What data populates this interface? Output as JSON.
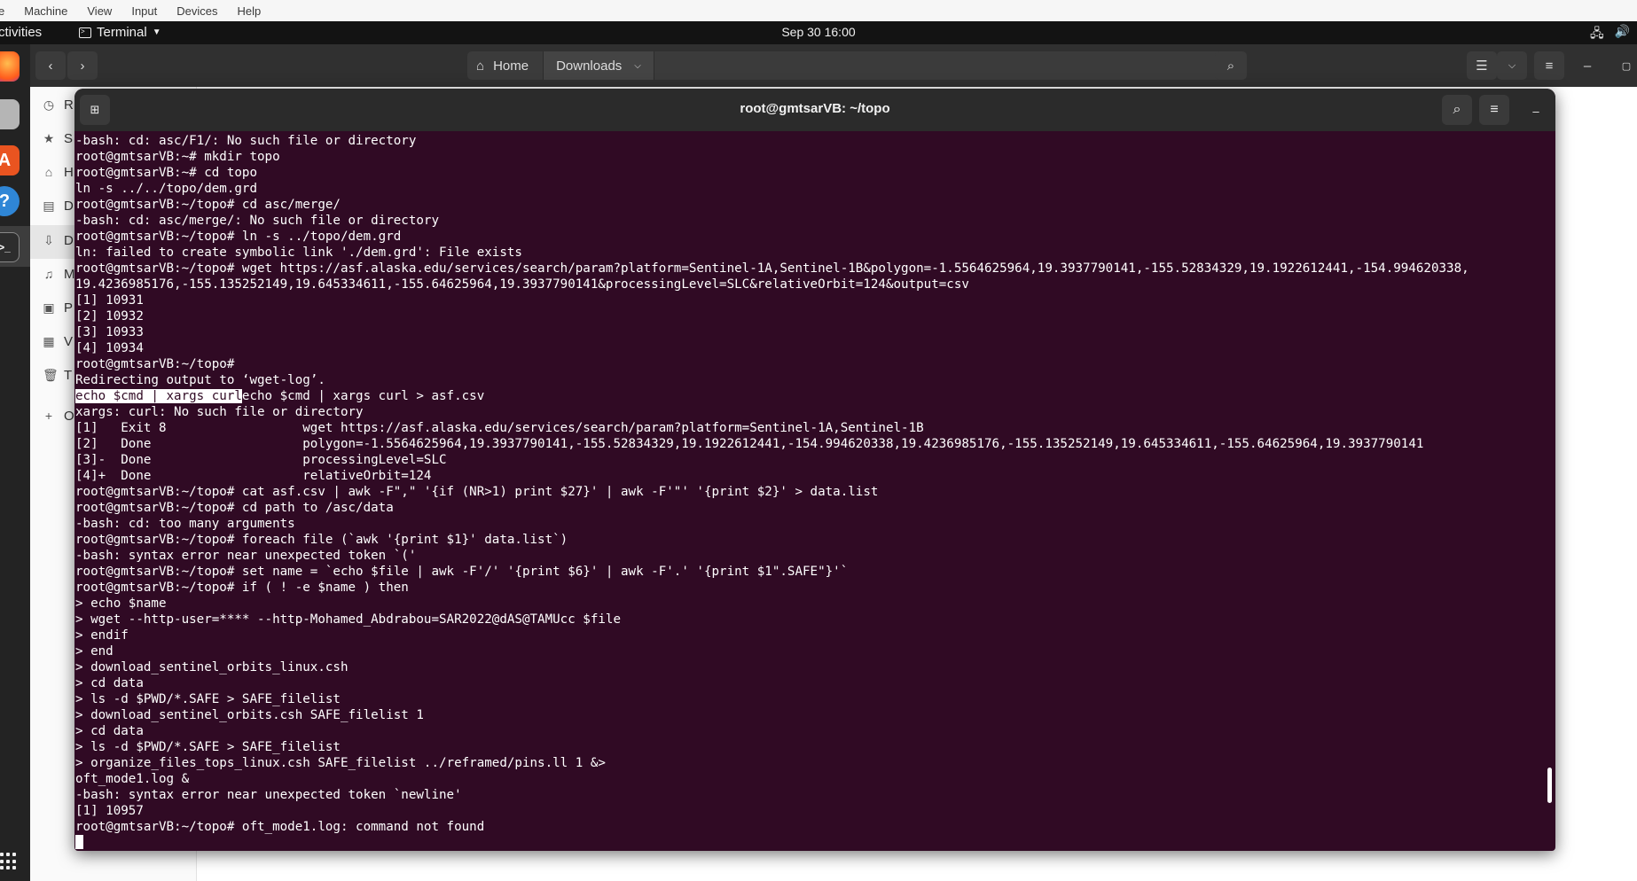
{
  "vbox_menu": {
    "items": [
      "e",
      "Machine",
      "View",
      "Input",
      "Devices",
      "Help"
    ]
  },
  "topbar": {
    "activities": "ctivities",
    "app_name": "Terminal",
    "clock": "Sep 30  16:00"
  },
  "files": {
    "path": {
      "home": "Home",
      "downloads": "Downloads"
    },
    "sidebar": [
      {
        "label": "R",
        "icon": "recent-icon"
      },
      {
        "label": "S",
        "icon": "star-icon"
      },
      {
        "label": "H",
        "icon": "home-icon"
      },
      {
        "label": "D",
        "icon": "documents-icon"
      },
      {
        "label": "D",
        "icon": "downloads-icon"
      },
      {
        "label": "M",
        "icon": "music-icon"
      },
      {
        "label": "P",
        "icon": "pictures-icon"
      },
      {
        "label": "V",
        "icon": "videos-icon"
      },
      {
        "label": "T",
        "icon": "trash-icon"
      },
      {
        "label": "O",
        "icon": "plus-icon"
      }
    ]
  },
  "terminal": {
    "title": "root@gmtsarVB: ~/topo",
    "lines": [
      "-bash: cd: asc/F1/: No such file or directory",
      "root@gmtsarVB:~# mkdir topo",
      "root@gmtsarVB:~# cd topo",
      "ln -s ../../topo/dem.grd",
      "root@gmtsarVB:~/topo# cd asc/merge/",
      "-bash: cd: asc/merge/: No such file or directory",
      "root@gmtsarVB:~/topo# ln -s ../topo/dem.grd",
      "ln: failed to create symbolic link './dem.grd': File exists",
      "root@gmtsarVB:~/topo# wget https://asf.alaska.edu/services/search/param?platform=Sentinel-1A,Sentinel-1B&polygon=-1.5564625964,19.3937790141,-155.52834329,19.1922612441,-154.994620338,",
      "19.4236985176,-155.135252149,19.645334611,-155.64625964,19.3937790141&processingLevel=SLC&relativeOrbit=124&output=csv",
      "[1] 10931",
      "[2] 10932",
      "[3] 10933",
      "[4] 10934",
      "root@gmtsarVB:~/topo#",
      "Redirecting output to ‘wget-log’.",
      "",
      "xargs: curl: No such file or directory",
      "[1]   Exit 8                  wget https://asf.alaska.edu/services/search/param?platform=Sentinel-1A,Sentinel-1B",
      "[2]   Done                    polygon=-1.5564625964,19.3937790141,-155.52834329,19.1922612441,-154.994620338,19.4236985176,-155.135252149,19.645334611,-155.64625964,19.3937790141",
      "[3]-  Done                    processingLevel=SLC",
      "[4]+  Done                    relativeOrbit=124",
      "root@gmtsarVB:~/topo# cat asf.csv | awk -F\",\" '{if (NR>1) print $27}' | awk -F'\"' '{print $2}' > data.list",
      "root@gmtsarVB:~/topo# cd path to /asc/data",
      "-bash: cd: too many arguments",
      "root@gmtsarVB:~/topo# foreach file (`awk '{print $1}' data.list`)",
      "-bash: syntax error near unexpected token `('",
      "root@gmtsarVB:~/topo# set name = `echo $file | awk -F'/' '{print $6}' | awk -F'.' '{print $1\".SAFE\"}'`",
      "root@gmtsarVB:~/topo# if ( ! -e $name ) then",
      "> echo $name",
      "> wget --http-user=**** --http-Mohamed_Abdrabou=SAR2022@dAS@TAMUcc $file",
      "> endif",
      "> end",
      "> download_sentinel_orbits_linux.csh",
      "> cd data",
      "> ls -d $PWD/*.SAFE > SAFE_filelist",
      "> download_sentinel_orbits.csh SAFE_filelist 1",
      "> cd data",
      "> ls -d $PWD/*.SAFE > SAFE_filelist",
      "> organize_files_tops_linux.csh SAFE_filelist ../reframed/pins.ll 1 &>",
      "oft_mode1.log &",
      "-bash: syntax error near unexpected token `newline'",
      "[1] 10957",
      "root@gmtsarVB:~/topo# oft_mode1.log: command not found"
    ],
    "selection": {
      "highlighted": "echo $cmd | xargs curl",
      "rest": "echo $cmd | xargs curl > asf.csv"
    }
  }
}
